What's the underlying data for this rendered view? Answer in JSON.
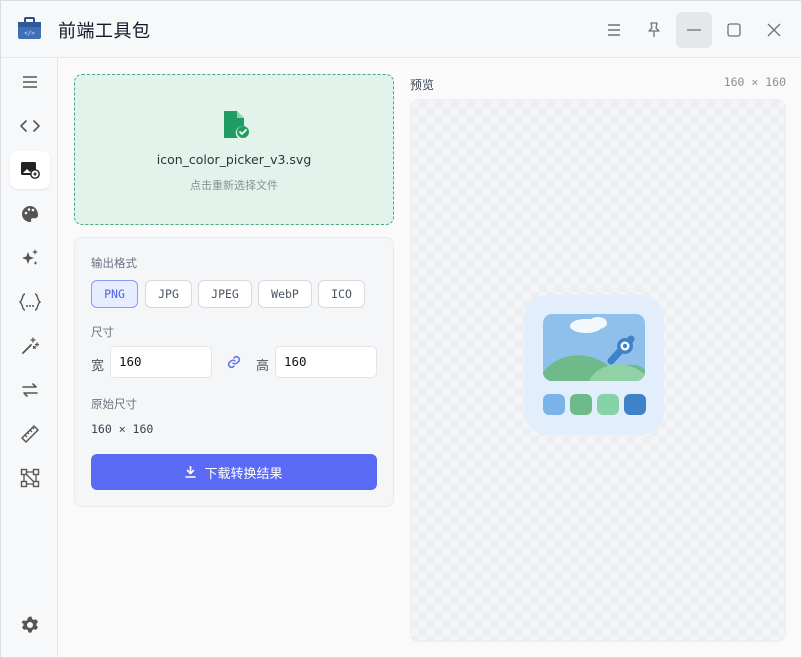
{
  "window": {
    "title": "前端工具包",
    "controls": [
      "menu-icon",
      "pin-icon",
      "minimize-icon",
      "maximize-icon",
      "close-icon"
    ]
  },
  "sidebar": {
    "items": [
      {
        "icon": "hamburger-icon"
      },
      {
        "icon": "code-icon"
      },
      {
        "icon": "image-convert-icon",
        "active": true
      },
      {
        "icon": "palette-icon"
      },
      {
        "icon": "sparkles-icon"
      },
      {
        "icon": "json-braces-icon"
      },
      {
        "icon": "magic-wand-icon"
      },
      {
        "icon": "swap-arrows-icon"
      },
      {
        "icon": "ruler-icon"
      },
      {
        "icon": "vector-nodes-icon"
      }
    ],
    "footer_icon": "settings-icon"
  },
  "upload": {
    "file_name": "icon_color_picker_v3.svg",
    "hint": "点击重新选择文件"
  },
  "settings": {
    "format_label": "输出格式",
    "formats": [
      "PNG",
      "JPG",
      "JPEG",
      "WebP",
      "ICO"
    ],
    "selected_format": "PNG",
    "size_label": "尺寸",
    "width_label": "宽",
    "width_value": "160",
    "height_label": "高",
    "height_value": "160",
    "original_label": "原始尺寸",
    "original_value": "160 × 160",
    "download_label": "下载转换结果"
  },
  "preview": {
    "title": "预览",
    "size": "160 × 160"
  },
  "colors": {
    "accent": "#5b6af5",
    "dropzone_border": "#4aa87a",
    "dropzone_bg": "#e2f3ec",
    "file_icon": "#1f9d62"
  }
}
